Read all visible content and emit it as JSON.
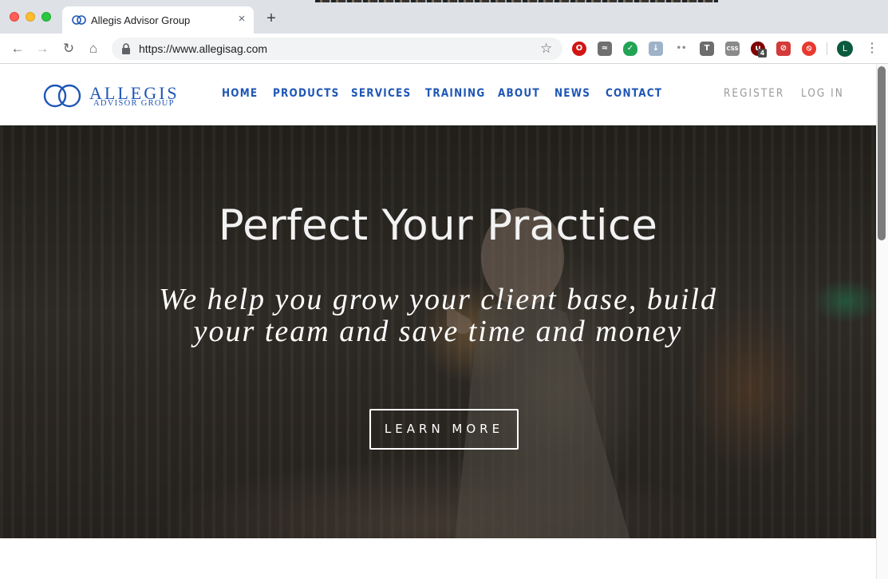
{
  "browser": {
    "tab_title": "Allegis Advisor Group",
    "tab_close": "×",
    "new_tab": "+",
    "url": "https://www.allegisag.com",
    "profile_initial": "L",
    "nav": {
      "back": "←",
      "forward": "→",
      "reload": "↻",
      "home": "⌂",
      "star": "☆",
      "menu": "⋮"
    },
    "extensions": [
      {
        "icon": "opera-o-icon",
        "color": "#d21414",
        "glyph": "O"
      },
      {
        "icon": "disguise-hat-icon",
        "color": "#6f6f6f",
        "glyph": "≈"
      },
      {
        "icon": "shield-check-icon",
        "color": "#23a455",
        "glyph": "✓"
      },
      {
        "icon": "download-arrow-icon",
        "color": "#9fb3c8",
        "glyph": "↓"
      },
      {
        "icon": "two-dots-icon",
        "color": "#8a8a8a",
        "glyph": "••"
      },
      {
        "icon": "t-letter-icon",
        "color": "#6d6d6d",
        "glyph": "T"
      },
      {
        "icon": "css-icon",
        "color": "#8a8a8a",
        "glyph": "CSS"
      },
      {
        "icon": "ublock-icon",
        "color": "#800000",
        "glyph": "u",
        "badge": "4"
      },
      {
        "icon": "adblock-red-icon",
        "color": "#d43a3a",
        "glyph": "⊘"
      },
      {
        "icon": "compass-icon",
        "color": "#e8392f",
        "glyph": "⦸"
      }
    ]
  },
  "site": {
    "logo_word": "ALLEGIS",
    "logo_sub": "ADVISOR GROUP",
    "nav": [
      "HOME",
      "PRODUCTS",
      "SERVICES",
      "TRAINING",
      "ABOUT",
      "NEWS",
      "CONTACT"
    ],
    "account": {
      "register": "REGISTER",
      "login": "LOG IN"
    },
    "brand_color": "#1f57b5"
  },
  "hero": {
    "title": "Perfect Your Practice",
    "subtitle": "We help you grow your client base, build your team and save time and money",
    "cta": "LEARN MORE"
  }
}
